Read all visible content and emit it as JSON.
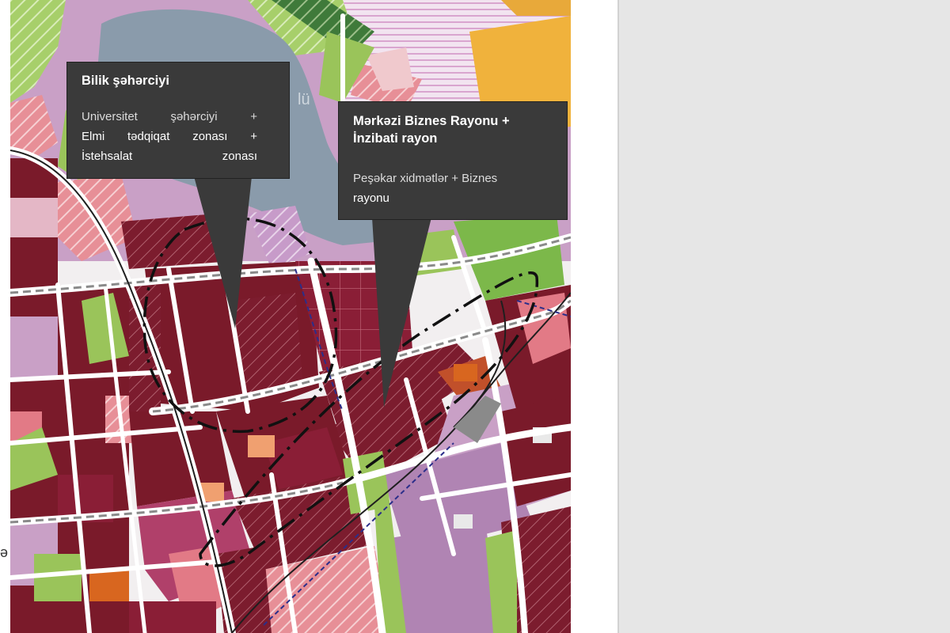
{
  "map": {
    "partial_label": "lü",
    "edge_char": "ə"
  },
  "callouts": [
    {
      "title": "Bilik şəhərciyi",
      "line1": "Universitet şəhərciyi +",
      "line2": "Elmi tədqiqat zonası +",
      "line3": "İstehsalat zonası"
    },
    {
      "title_line1": "Mərkəzi Biznes Rayonu +",
      "title_line2": "İnzibati rayon",
      "line1": "Peşəkar xidmətlər + Biznes",
      "line2": "rayonu"
    }
  ],
  "colors": {
    "callout_bg": "#3a3a3a",
    "residential_dark": "#7a1a2a",
    "commercial": "#8a1e36",
    "mixed_use": "#b084b3",
    "green_space": "#9ac45a",
    "water": "#8a9bab",
    "public": "#f0b23c",
    "pink_residential": "#e2808a"
  }
}
